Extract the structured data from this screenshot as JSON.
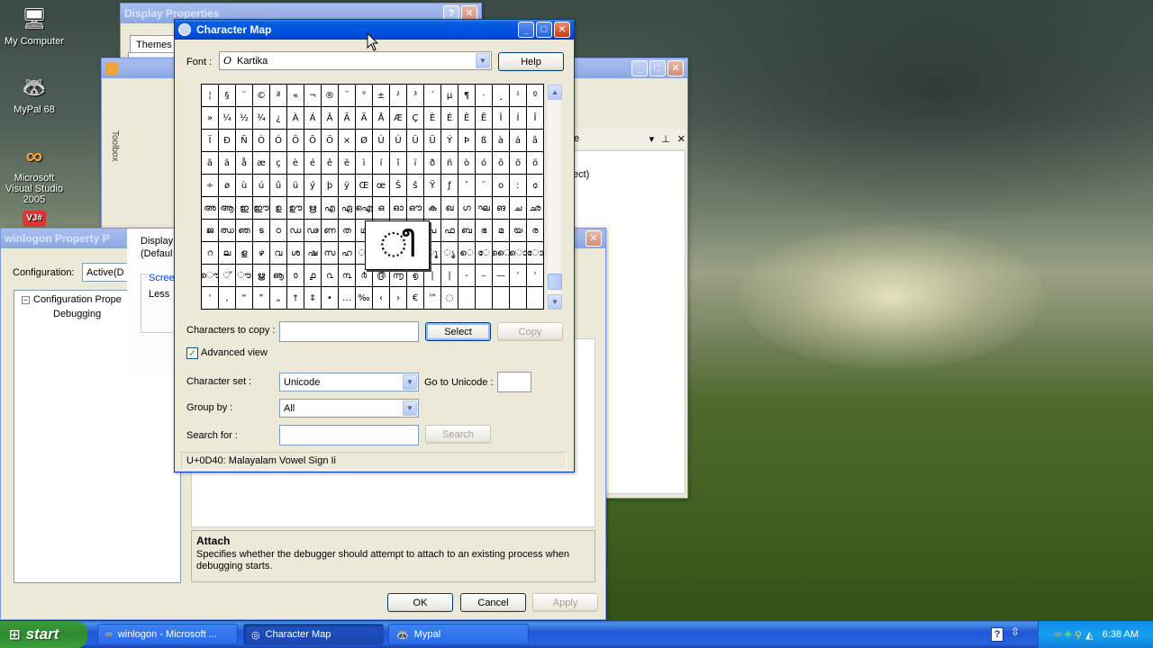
{
  "desktop": {
    "icons": [
      {
        "label": "My Computer",
        "glyph": "🖥"
      },
      {
        "label": "MyPal 68",
        "glyph": "🦝"
      },
      {
        "label": "Microsoft Visual Studio 2005",
        "glyph": "∞"
      },
      {
        "label": "",
        "glyph": "VJ#"
      }
    ]
  },
  "display_properties": {
    "title": "Display Properties",
    "tab": "Themes"
  },
  "vs_window": {
    "toolbox_label": "Toolbox",
    "project_text": "ect)",
    "pane_letter": "e"
  },
  "winlogon": {
    "title": "winlogon Property P",
    "configuration_label": "Configuration:",
    "configuration_value": "Active(D",
    "tree_root": "Configuration Prope",
    "tree_child": "Debugging",
    "display_label": "Display:",
    "display_value": "(Defaul",
    "screen_label": "Scree",
    "less_label": "Less",
    "attach_title": "Attach",
    "attach_desc": "Specifies whether the debugger should attempt to attach to an existing process when debugging starts.",
    "ok": "OK",
    "cancel": "Cancel",
    "apply": "Apply"
  },
  "charmap": {
    "title": "Character Map",
    "font_label": "Font :",
    "font_value": "Kartika",
    "help": "Help",
    "chars": [
      "¦",
      "§",
      "¨",
      "©",
      "ª",
      "«",
      "¬",
      "®",
      "¯",
      "°",
      "±",
      "²",
      "³",
      "´",
      "µ",
      "¶",
      "·",
      "¸",
      "¹",
      "º",
      "»",
      "¼",
      "½",
      "¾",
      "¿",
      "À",
      "Á",
      "Â",
      "Ã",
      "Ä",
      "Å",
      "Æ",
      "Ç",
      "È",
      "É",
      "Ê",
      "Ë",
      "Ì",
      "Í",
      "Î",
      "Ï",
      "Ð",
      "Ñ",
      "Ò",
      "Ó",
      "Ô",
      "Õ",
      "Ö",
      "×",
      "Ø",
      "Ù",
      "Ú",
      "Û",
      "Ü",
      "Ý",
      "Þ",
      "ß",
      "à",
      "á",
      "â",
      "ã",
      "ä",
      "å",
      "æ",
      "ç",
      "è",
      "é",
      "ê",
      "ë",
      "ì",
      "í",
      "î",
      "ï",
      "ð",
      "ñ",
      "ò",
      "ó",
      "ô",
      "õ",
      "ö",
      "÷",
      "ø",
      "ù",
      "ú",
      "û",
      "ü",
      "ý",
      "þ",
      "ÿ",
      "Œ",
      "œ",
      "Š",
      "š",
      "Ÿ",
      "ƒ",
      "ˆ",
      "˜",
      "ο",
      "ː",
      "൦",
      "അ",
      "ആ",
      "ഇ",
      "ഈ",
      "ഉ",
      "ഊ",
      "ഋ",
      "എ",
      "ഏ",
      "ഐ",
      "ഒ",
      "ഓ",
      "ഔ",
      "ക",
      "ഖ",
      "ഗ",
      "ഘ",
      "ങ",
      "ച",
      "ഛ",
      "ജ",
      "ഝ",
      "ഞ",
      "ട",
      "ഠ",
      "ഡ",
      "ഢ",
      "ണ",
      "ത",
      "ഥ",
      "ദ",
      "ധ",
      "ന",
      "പ",
      "ഫ",
      "ബ",
      "ഭ",
      "മ",
      "യ",
      "ര",
      "റ",
      "ല",
      "ള",
      "ഴ",
      "വ",
      "ശ",
      "ഷ",
      "സ",
      "ഹ",
      "ാ",
      "ി",
      "ീ",
      "ു",
      "ൂ",
      "ൃ",
      "െ",
      "േ",
      "ൈ",
      "ൊ",
      "ോ",
      "ൌ",
      "്",
      "ൗ",
      "ൠ",
      "ൡ",
      "൦",
      "൧",
      "൨",
      "൩",
      "൪",
      "൫",
      "൬",
      "൭",
      "|",
      "|",
      "-",
      "–",
      "—",
      "'",
      "'",
      "'",
      ",",
      "“",
      "”",
      "„",
      "†",
      "‡",
      "•",
      "…",
      "‰",
      "‹",
      "›",
      "€",
      "™",
      "◌",
      "",
      "",
      "",
      "",
      ""
    ],
    "magnified_char": "ീ",
    "chars_to_copy_label": "Characters to copy :",
    "chars_to_copy_value": "",
    "select": "Select",
    "copy": "Copy",
    "advanced_view": "Advanced view",
    "advanced_checked": true,
    "character_set_label": "Character set :",
    "character_set_value": "Unicode",
    "go_to_unicode_label": "Go to Unicode :",
    "go_to_unicode_value": "",
    "group_by_label": "Group by :",
    "group_by_value": "All",
    "search_for_label": "Search for :",
    "search_for_value": "",
    "search": "Search",
    "status": "U+0D40: Malayalam Vowel Sign Ii"
  },
  "taskbar": {
    "start": "start",
    "tasks": [
      {
        "label": "winlogon - Microsoft ...",
        "active": false
      },
      {
        "label": "Character Map",
        "active": true
      },
      {
        "label": "Mypal",
        "active": false
      }
    ],
    "clock": "6:38 AM"
  }
}
